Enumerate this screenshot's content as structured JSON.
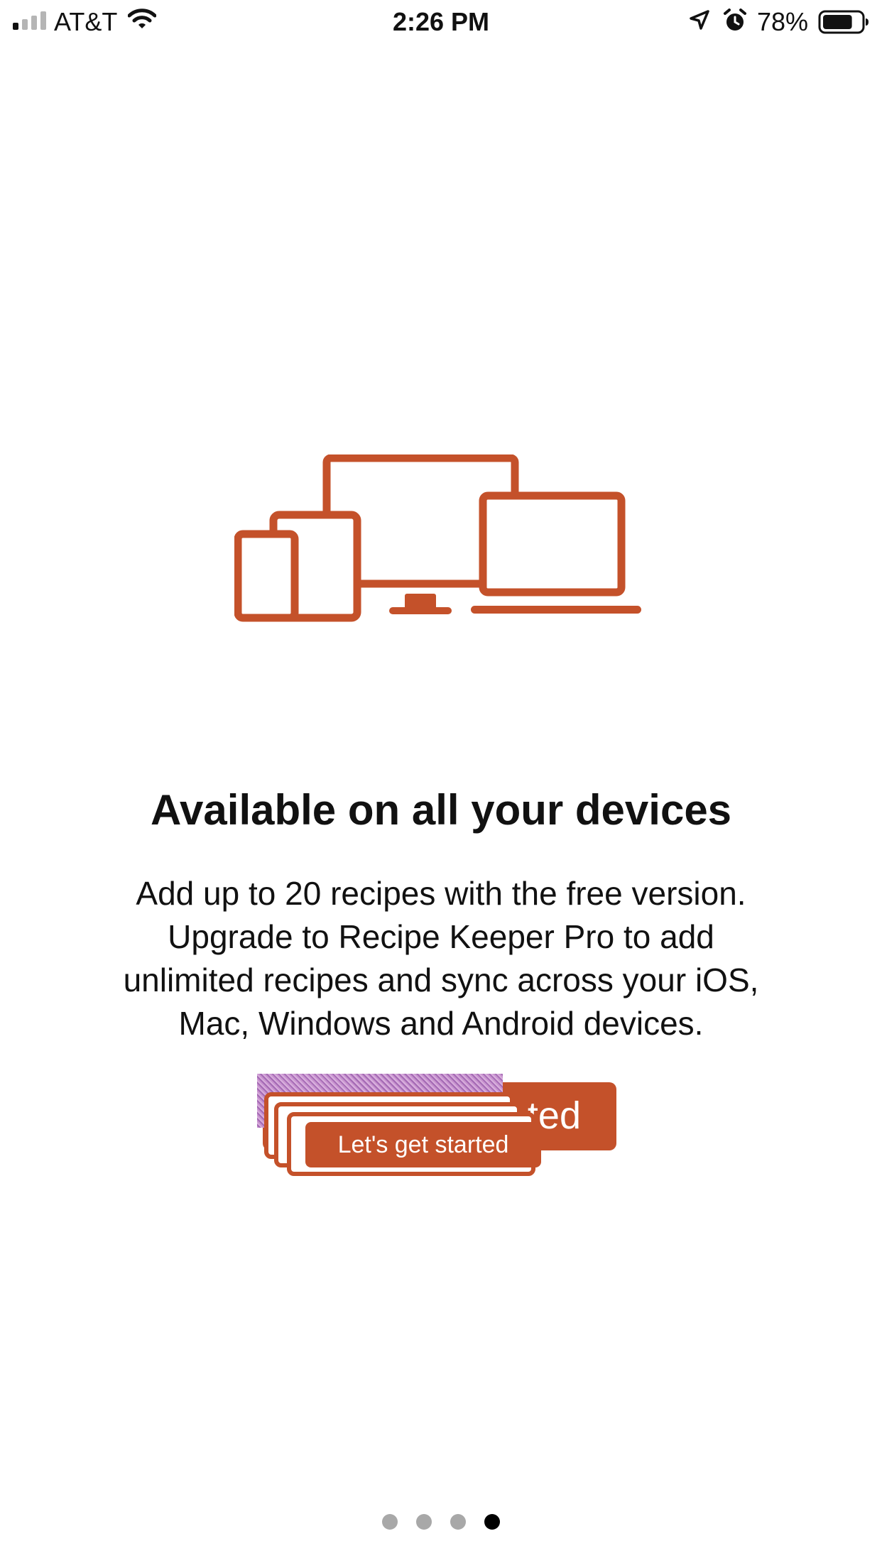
{
  "status_bar": {
    "carrier": "AT&T",
    "time": "2:26 PM",
    "battery_percent": "78%",
    "battery_level": 0.78,
    "signal_bars_active": 1,
    "signal_bars_total": 4
  },
  "onboarding": {
    "illustration": "devices-icon",
    "title": "Available on all your devices",
    "description_lines": [
      "Add up to 20 recipes with the free version.",
      "Upgrade to Recipe Keeper Pro to add",
      "unlimited recipes and sync across your iOS,",
      "Mac, Windows and Android devices."
    ],
    "button_back_partial_label": "ted",
    "cta_button_label": "Let's get started"
  },
  "pagination": {
    "total": 4,
    "active_index": 3
  },
  "colors": {
    "accent": "#c4512a",
    "dot_inactive": "#a8a8a8",
    "dot_active": "#000000",
    "background": "#ffffff"
  }
}
